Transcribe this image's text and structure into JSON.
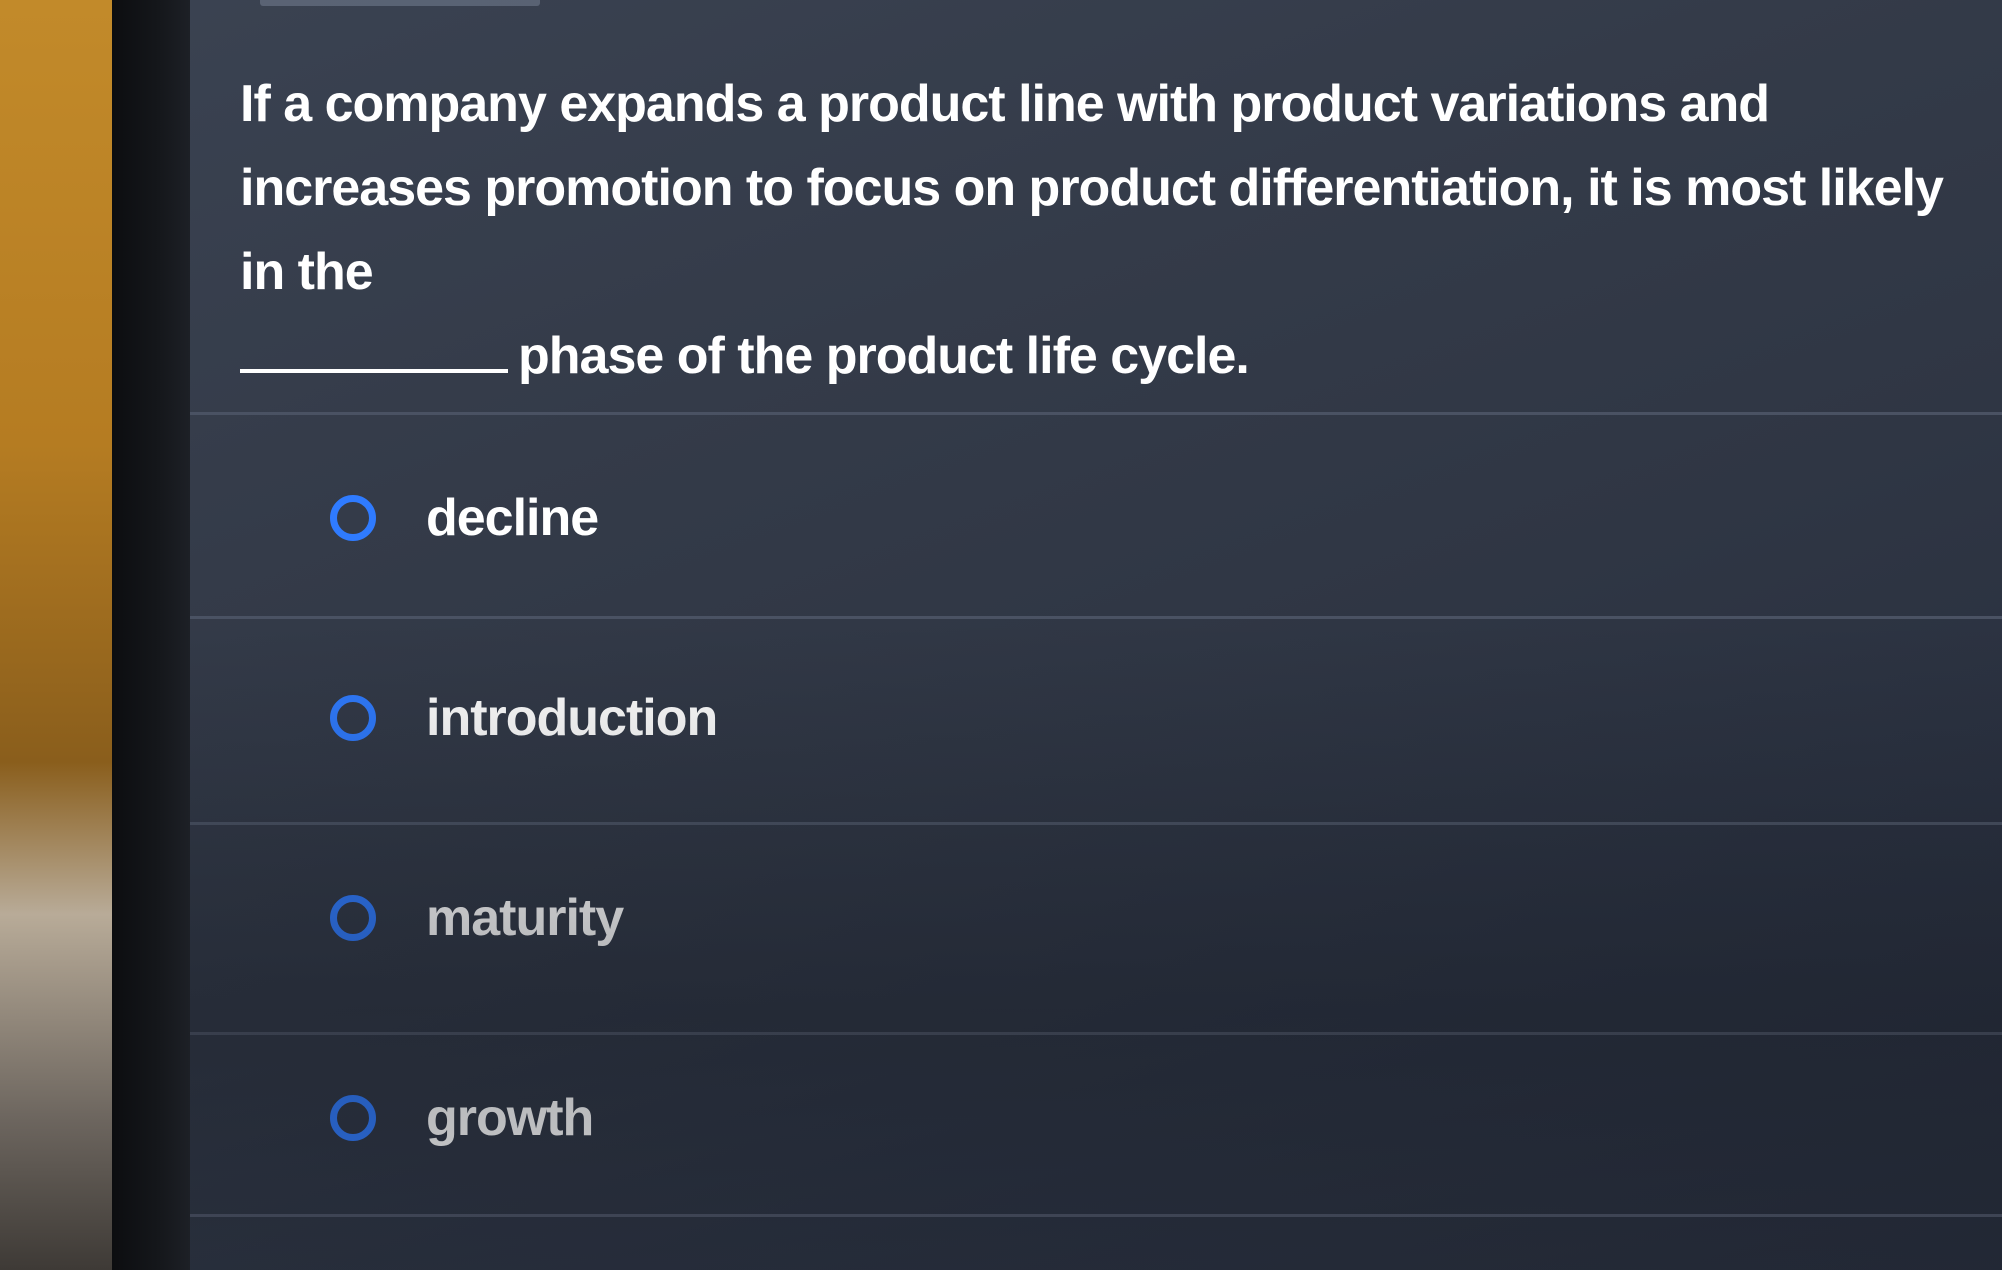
{
  "question": {
    "text_before": "If a company expands a product line with product variations and increases promotion to focus on product differentiation, it is most likely in the",
    "text_after": "phase of the product life cycle."
  },
  "options": [
    {
      "label": "decline",
      "selected": false
    },
    {
      "label": "introduction",
      "selected": false
    },
    {
      "label": "maturity",
      "selected": false
    },
    {
      "label": "growth",
      "selected": false
    }
  ],
  "colors": {
    "radio_accent": "#2f7bff",
    "text": "#ffffff",
    "screen_background": "#2f3644"
  }
}
